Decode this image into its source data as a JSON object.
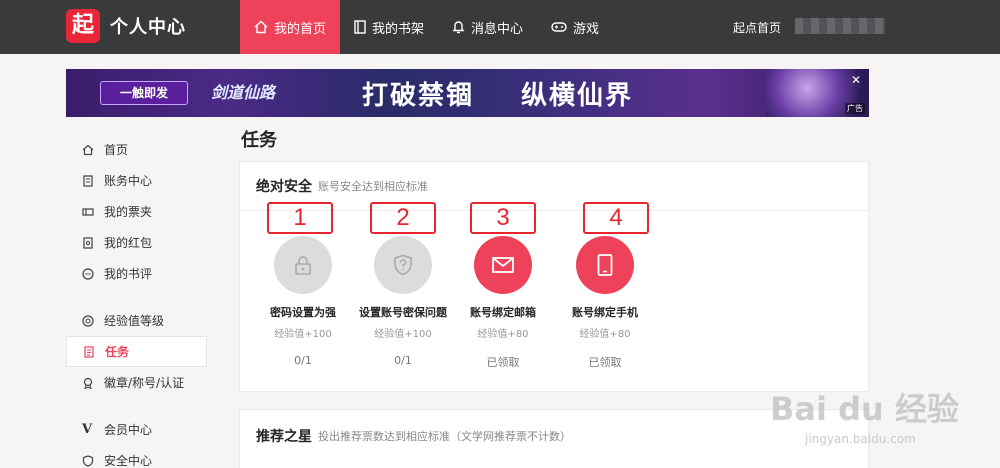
{
  "header": {
    "logo_glyph": "起",
    "title": "个人中心",
    "nav": [
      {
        "label": "我的首页",
        "icon": "home-icon"
      },
      {
        "label": "我的书架",
        "icon": "book-icon"
      },
      {
        "label": "消息中心",
        "icon": "bell-icon"
      },
      {
        "label": "游戏",
        "icon": "gamepad-icon"
      }
    ],
    "top_link": "起点首页"
  },
  "banner": {
    "badge": "一触即发",
    "sub": "剑道仙路",
    "main": "打破禁锢",
    "main2": "纵横仙界",
    "close": "✕",
    "ad": "广告"
  },
  "sidebar": {
    "items": [
      {
        "label": "首页",
        "icon": "home-icon"
      },
      {
        "label": "账务中心",
        "icon": "bill-icon"
      },
      {
        "label": "我的票夹",
        "icon": "ticket-icon"
      },
      {
        "label": "我的红包",
        "icon": "redpacket-icon"
      },
      {
        "label": "我的书评",
        "icon": "comment-icon"
      },
      {
        "label": "经验值等级",
        "icon": "level-icon"
      },
      {
        "label": "任务",
        "icon": "task-icon"
      },
      {
        "label": "徽章/称号/认证",
        "icon": "badge-icon"
      },
      {
        "label": "会员中心",
        "icon": "vip-icon"
      },
      {
        "label": "安全中心",
        "icon": "shield-icon"
      }
    ],
    "vip_glyph": "V"
  },
  "main": {
    "title": "任务",
    "section1": {
      "title": "绝对安全",
      "subtitle": "账号安全达到相应标准",
      "tasks": [
        {
          "name": "密码设置为强",
          "exp": "经验值+100",
          "status": "0/1",
          "icon": "lock-icon",
          "marker": "1"
        },
        {
          "name": "设置账号密保问题",
          "exp": "经验值+100",
          "status": "0/1",
          "icon": "shield-question-icon",
          "marker": "2"
        },
        {
          "name": "账号绑定邮箱",
          "exp": "经验值+80",
          "status": "已领取",
          "icon": "mail-icon",
          "marker": "3"
        },
        {
          "name": "账号绑定手机",
          "exp": "经验值+80",
          "status": "已领取",
          "icon": "phone-icon",
          "marker": "4"
        }
      ]
    },
    "section2": {
      "title": "推荐之星",
      "subtitle": "投出推荐票数达到相应标准（文学网推荐票不计数）"
    }
  },
  "watermark": {
    "logo": "Bai du 经验",
    "url": "jingyan.baidu.com"
  },
  "colors": {
    "topbar": "#3a3a3d",
    "accent": "#ed4259",
    "marker": "#e8262f"
  }
}
